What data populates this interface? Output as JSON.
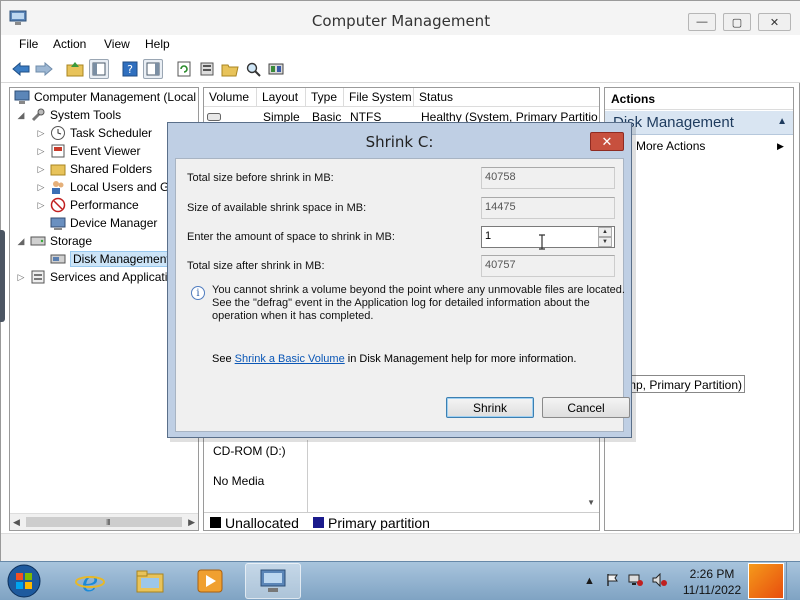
{
  "window": {
    "title": "Computer Management",
    "controls": {
      "minimize": "—",
      "maximize": "▢",
      "close": "✕"
    }
  },
  "menu": [
    "File",
    "Action",
    "View",
    "Help"
  ],
  "tree": {
    "root": "Computer Management (Local",
    "system_tools": "System Tools",
    "task_scheduler": "Task Scheduler",
    "event_viewer": "Event Viewer",
    "shared_folders": "Shared Folders",
    "local_users": "Local Users and Gr",
    "performance": "Performance",
    "device_manager": "Device Manager",
    "storage": "Storage",
    "disk_management": "Disk Management",
    "services": "Services and Applicatio",
    "scroll_grip": "III"
  },
  "volume_table": {
    "headers": [
      "Volume",
      "Layout",
      "Type",
      "File System",
      "Status"
    ],
    "row": {
      "layout": "Simple",
      "type": "Basic",
      "fs": "NTFS",
      "status": "Healthy (System, Primary Partitio"
    }
  },
  "disk_area": {
    "cdrom": "CD-ROM (D:)",
    "media": "No Media",
    "partition_tag": "mp, Primary Partition)"
  },
  "legend": {
    "unallocated": "Unallocated",
    "primary": "Primary partition",
    "unallocated_color": "#000000",
    "primary_color": "#1a1a8c"
  },
  "actions": {
    "header": "Actions",
    "section": "Disk Management",
    "more": "More Actions"
  },
  "dialog": {
    "title": "Shrink C:",
    "close": "✕",
    "total_before_label": "Total size before shrink in MB:",
    "total_before_value": "40758",
    "available_label": "Size of available shrink space in MB:",
    "available_value": "14475",
    "amount_label": "Enter the amount of space to shrink in MB:",
    "amount_value": "1",
    "total_after_label": "Total size after shrink in MB:",
    "total_after_value": "40757",
    "note_line1": "You cannot shrink a volume beyond the point where any unmovable files are located.",
    "note_line2": "See the \"defrag\" event in the Application log for detailed information about the",
    "note_line3": "operation when it has completed.",
    "see_prefix": "See ",
    "see_link": "Shrink a Basic Volume",
    "see_suffix": " in Disk Management help for more information.",
    "shrink_button": "Shrink",
    "cancel_button": "Cancel"
  },
  "taskbar": {
    "time": "2:26 PM",
    "date": "11/11/2022"
  }
}
